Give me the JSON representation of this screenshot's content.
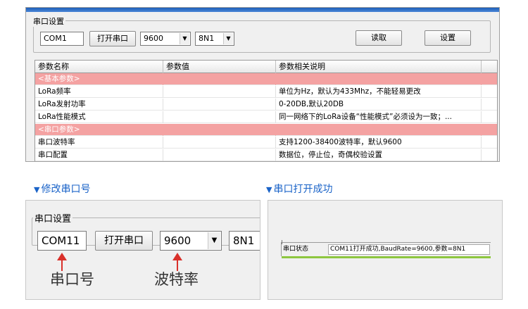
{
  "top": {
    "group_title": "串口设置",
    "port": "COM1",
    "open_button": "打开串口",
    "baud": "9600",
    "format": "8N1",
    "read_button": "读取",
    "set_button": "设置",
    "table": {
      "headers": [
        "参数名称",
        "参数值",
        "参数相关说明"
      ],
      "rows": [
        {
          "name": "<基本参数>",
          "value": "",
          "desc": "",
          "category": true
        },
        {
          "name": "LoRa频率",
          "value": "",
          "desc": "单位为Hz，默认为433Mhz，不能轻易更改"
        },
        {
          "name": "LoRa发射功率",
          "value": "",
          "desc": "0-20DB,默认20DB"
        },
        {
          "name": "LoRa性能模式",
          "value": "",
          "desc": "同一网络下的LoRa设备“性能模式”必须设为一致；..."
        },
        {
          "name": "<串口参数>",
          "value": "",
          "desc": "",
          "category": true
        },
        {
          "name": "串口波特率",
          "value": "",
          "desc": "支持1200-38400波特率，默认9600"
        },
        {
          "name": "串口配置",
          "value": "",
          "desc": "数据位，停止位，奇偶校验设置"
        }
      ]
    }
  },
  "captions": {
    "left": "修改串口号",
    "right": "串口打开成功",
    "marker": "▼"
  },
  "zoom_left": {
    "group_title": "串口设置",
    "port": "COM11",
    "open_button": "打开串口",
    "baud": "9600",
    "format": "8N1",
    "label_port": "串口号",
    "label_baud": "波特率"
  },
  "zoom_right": {
    "status_label": "串口状态",
    "status_value": "COM11打开成功,BaudRate=9600,参数=8N1"
  },
  "colors": {
    "accent": "#1a63c8",
    "category_row": "#f4a2a2",
    "arrow": "#d9302a",
    "status_bar": "#8dc63f"
  }
}
